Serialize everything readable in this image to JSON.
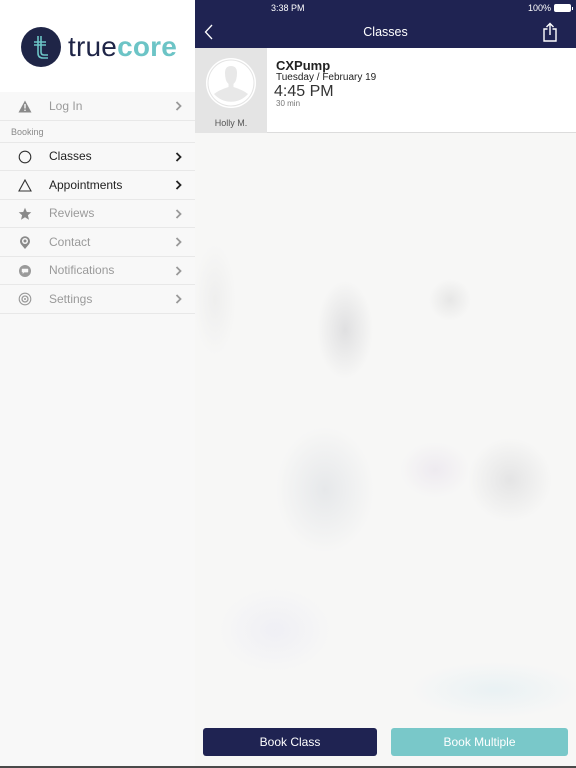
{
  "status_bar": {
    "time": "3:38 PM",
    "battery": "100%"
  },
  "sidebar": {
    "logo": {
      "part1": "true",
      "part2": "core",
      "monogram": "t"
    },
    "items": [
      {
        "label": "Log In",
        "icon": "warning-icon"
      },
      {
        "section": "Booking"
      },
      {
        "label": "Classes",
        "icon": "circle-icon"
      },
      {
        "label": "Appointments",
        "icon": "triangle-icon"
      },
      {
        "label": "Reviews",
        "icon": "star-icon"
      },
      {
        "label": "Contact",
        "icon": "location-pin-icon"
      },
      {
        "label": "Notifications",
        "icon": "chat-bubble-icon"
      },
      {
        "label": "Settings",
        "icon": "gear-icon"
      }
    ]
  },
  "nav": {
    "title": "Classes"
  },
  "class_card": {
    "instructor": "Holly M.",
    "name": "CXPump",
    "date": "Tuesday / February 19",
    "time": "4:45 PM",
    "duration": "30 min"
  },
  "actions": {
    "book_class": "Book Class",
    "book_multiple": "Book Multiple"
  },
  "colors": {
    "navy": "#1f2352",
    "teal": "#79c8c9",
    "logo_teal": "#6cc4c6"
  }
}
